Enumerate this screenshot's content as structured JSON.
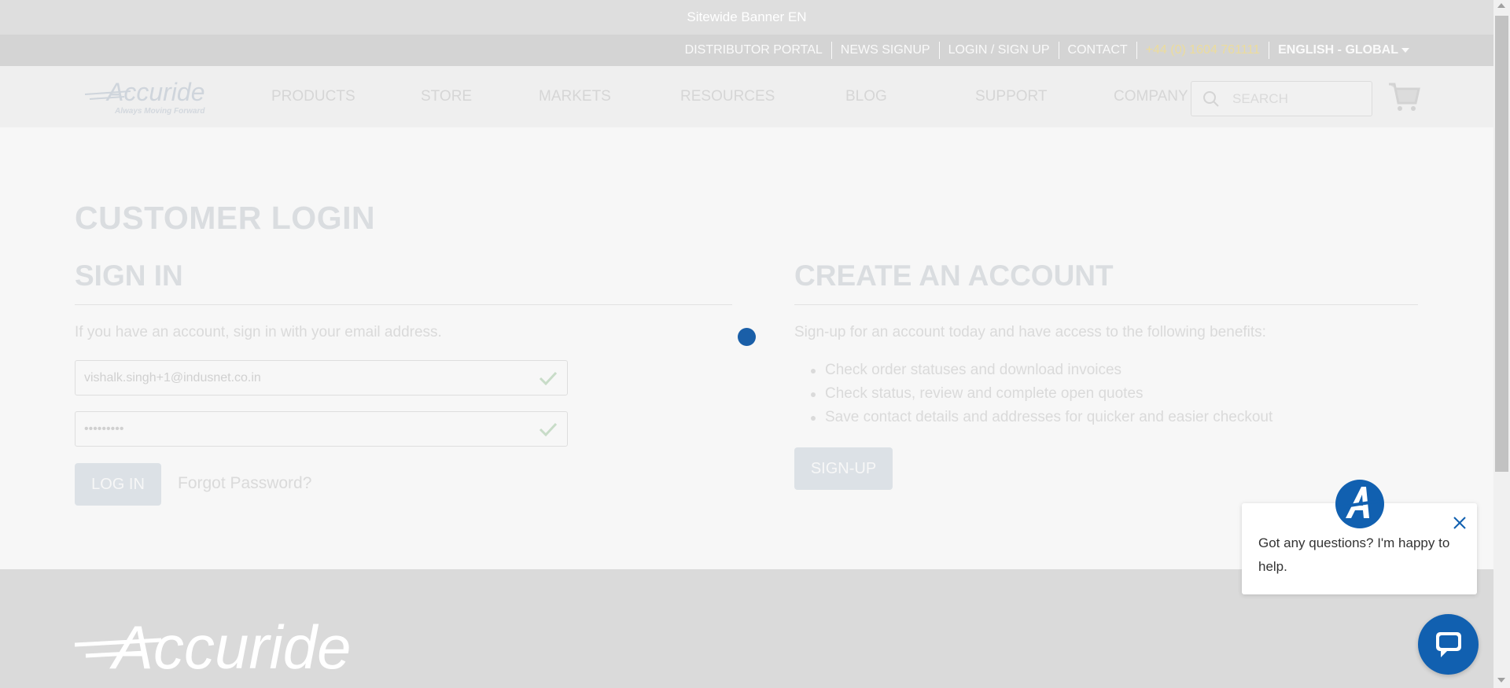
{
  "banner": {
    "text": "Sitewide Banner EN"
  },
  "utility_nav": {
    "items": [
      "DISTRIBUTOR PORTAL",
      "NEWS SIGNUP",
      "LOGIN / SIGN UP",
      "CONTACT"
    ],
    "phone": "+44 (0) 1604 761111",
    "language": "ENGLISH - GLOBAL"
  },
  "header": {
    "logo_text": "Accuride",
    "logo_tagline": "Always Moving Forward",
    "nav": [
      "PRODUCTS",
      "STORE",
      "MARKETS",
      "RESOURCES",
      "BLOG",
      "SUPPORT",
      "COMPANY"
    ],
    "search_placeholder": "SEARCH"
  },
  "main": {
    "page_title": "CUSTOMER LOGIN",
    "sign_in": {
      "title": "SIGN IN",
      "intro": "If you have an account, sign in with your email address.",
      "email_value": "vishalk.singh+1@indusnet.co.in",
      "password_value": "•••••••••",
      "login_label": "LOG IN",
      "forgot_label": "Forgot Password?"
    },
    "create_account": {
      "title": "CREATE AN ACCOUNT",
      "intro": "Sign-up for an account today and have access to the following benefits:",
      "benefits": [
        "Check order statuses and download invoices",
        "Check status, review and complete open quotes",
        "Save contact details and addresses for quicker and easier checkout"
      ],
      "signup_label": "SIGN-UP"
    }
  },
  "footer": {
    "logo_text": "Accuride"
  },
  "chat": {
    "message": "Got any questions? I'm happy to help."
  },
  "colors": {
    "accent": "#1160b0",
    "phone": "#ecdc9c",
    "muted_text": "#dadada"
  }
}
